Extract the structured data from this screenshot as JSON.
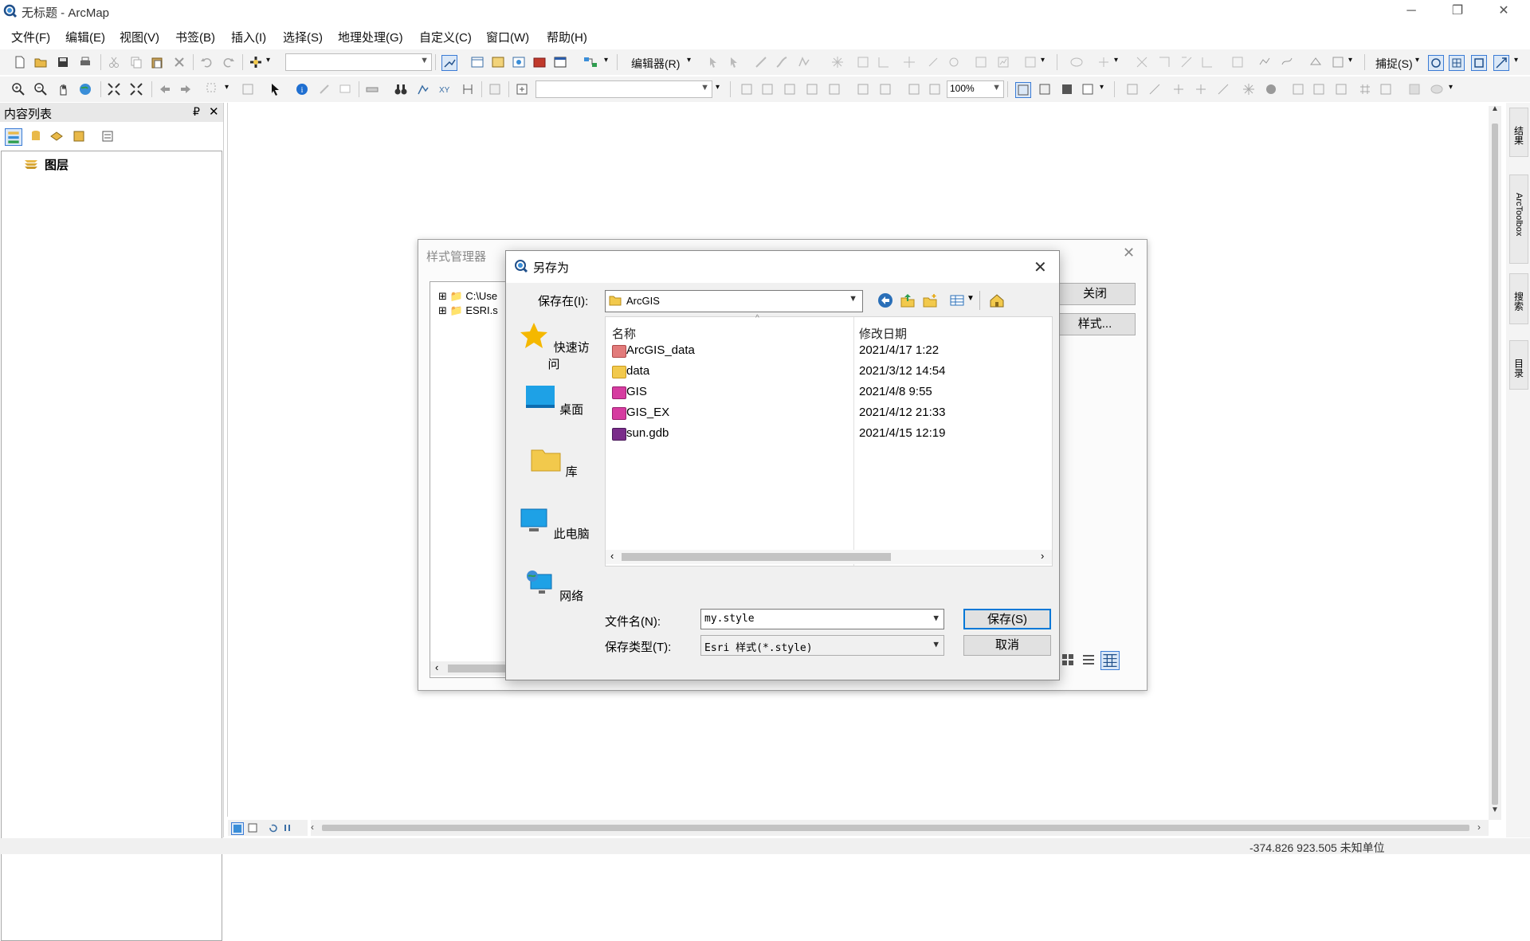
{
  "window": {
    "title": "无标题 - ArcMap",
    "minimize": "─",
    "restore": "❐",
    "close": "✕"
  },
  "menubar": {
    "items": [
      "文件(F)",
      "编辑(E)",
      "视图(V)",
      "书签(B)",
      "插入(I)",
      "选择(S)",
      "地理处理(G)",
      "自定义(C)",
      "窗口(W)",
      "帮助(H)"
    ]
  },
  "toolbar": {
    "editor_label": "编辑器(R)",
    "snapping_label": "捕捉(S)",
    "zoom_level": "100%"
  },
  "toc": {
    "title": "内容列表",
    "pin": "₽",
    "close": "✕",
    "layers_root": "图层"
  },
  "right_dock": {
    "tabs": [
      "结果",
      "ArcToolbox",
      "搜索",
      "目录"
    ]
  },
  "status": {
    "coords": "-374.826  923.505 未知单位"
  },
  "style_manager": {
    "title": "样式管理器",
    "tree_items": [
      "C:\\Use",
      "ESRI.s"
    ],
    "close_button": "关闭",
    "styles_button": "样式..."
  },
  "save_as": {
    "title": "另存为",
    "save_in_label": "保存在(I):",
    "save_in_value": "ArcGIS",
    "places": [
      "快速访问",
      "桌面",
      "库",
      "此电脑",
      "网络"
    ],
    "columns": {
      "name": "名称",
      "modified": "修改日期"
    },
    "files": [
      {
        "name": "ArcGIS_data",
        "modified": "2021/4/17 1:22"
      },
      {
        "name": "data",
        "modified": "2021/3/12 14:54"
      },
      {
        "name": "GIS",
        "modified": "2021/4/8 9:55"
      },
      {
        "name": "GIS_EX",
        "modified": "2021/4/12 21:33"
      },
      {
        "name": "sun.gdb",
        "modified": "2021/4/15 12:19"
      }
    ],
    "filename_label": "文件名(N):",
    "filename_value": "my.style",
    "filetype_label": "保存类型(T):",
    "filetype_value": "Esri 样式(*.style)",
    "save_button": "保存(S)",
    "cancel_button": "取消"
  },
  "colors": {
    "accent": "#0078d7",
    "folder": "#f2c94c",
    "gdb": "#7a2c8a"
  }
}
